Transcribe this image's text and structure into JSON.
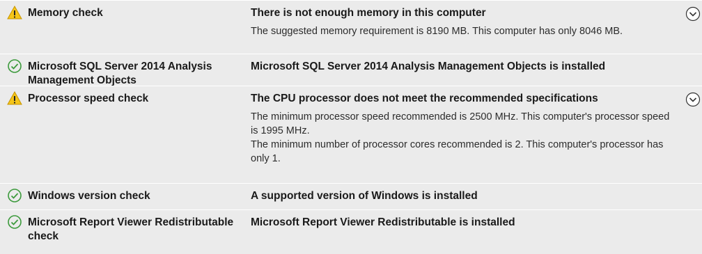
{
  "checks": [
    {
      "status": "warning",
      "status_icon": "warning-icon",
      "name": "Memory check",
      "title": "There is not enough memory in this computer",
      "details": [
        "The suggested memory requirement is 8190 MB. This computer has only 8046 MB."
      ],
      "expandable": true
    },
    {
      "status": "passed",
      "status_icon": "check-circle-icon",
      "name": "Microsoft SQL Server 2014 Analysis Management Objects",
      "title": "Microsoft SQL Server 2014 Analysis Management Objects is installed",
      "details": [],
      "expandable": false
    },
    {
      "status": "warning",
      "status_icon": "warning-icon",
      "name": "Processor speed check",
      "title": "The CPU processor does not meet the recommended specifications",
      "details": [
        "The minimum processor speed recommended is 2500 MHz. This computer's processor speed is 1995 MHz.",
        "The minimum number of processor cores recommended is 2. This computer's processor has only 1."
      ],
      "expandable": true
    },
    {
      "status": "passed",
      "status_icon": "check-circle-icon",
      "name": "Windows version check",
      "title": "A supported version of Windows is installed",
      "details": [],
      "expandable": false
    },
    {
      "status": "passed",
      "status_icon": "check-circle-icon",
      "name": "Microsoft Report Viewer Redistributable check",
      "title": "Microsoft Report Viewer Redistributable is installed",
      "details": [],
      "expandable": false
    }
  ],
  "colors": {
    "warning_fill": "#f5c518",
    "passed_stroke": "#3c9a3c",
    "background": "#ebebeb"
  }
}
